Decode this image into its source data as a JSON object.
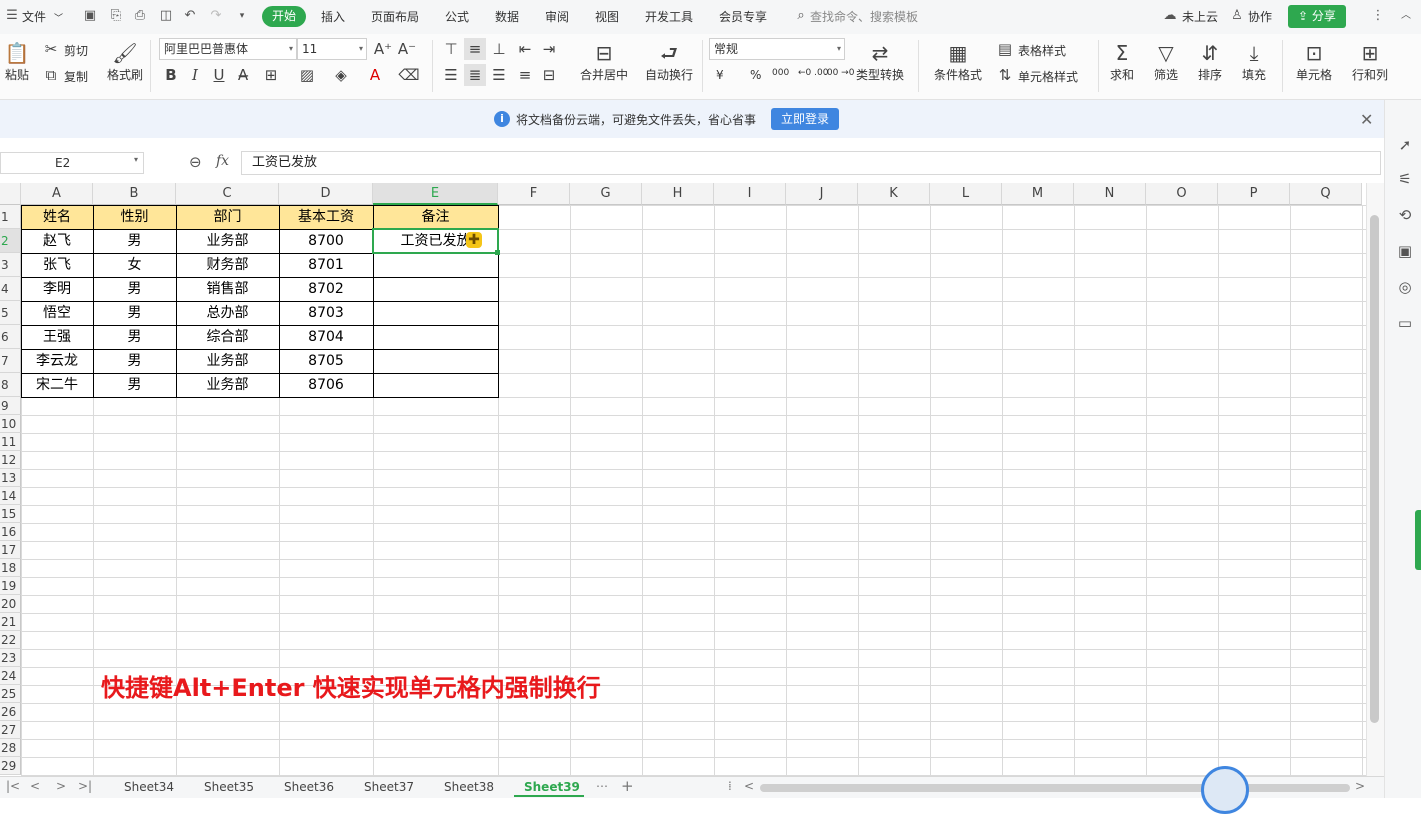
{
  "menu": {
    "file": "文件",
    "tabs": [
      "开始",
      "插入",
      "页面布局",
      "公式",
      "数据",
      "审阅",
      "视图",
      "开发工具",
      "会员专享"
    ],
    "search_placeholder": "查找命令、搜索模板",
    "cloud": "未上云",
    "collab": "协作",
    "share": "分享"
  },
  "ribbon": {
    "paste": "粘贴",
    "cut": "剪切",
    "copy": "复制",
    "format_painter": "格式刷",
    "font_name": "阿里巴巴普惠体",
    "font_size": "11",
    "merge_center": "合并居中",
    "wrap_text": "自动换行",
    "number_format": "常规",
    "currency": "¥",
    "percent": "%",
    "thousands": "000",
    "inc_decimal": "←0 .00",
    "dec_decimal": ".00 →0",
    "type_convert": "类型转换",
    "cond_format": "条件格式",
    "table_style": "表格样式",
    "cell_style": "单元格样式",
    "sum": "求和",
    "filter": "筛选",
    "sort": "排序",
    "fill": "填充",
    "cell": "单元格",
    "rows_cols": "行和列"
  },
  "notice": {
    "text": "将文档备份云端，可避免文件丢失，省心省事",
    "login": "立即登录"
  },
  "formula_bar": {
    "name_box": "E2",
    "fx": "fx",
    "content": "工资已发放"
  },
  "columns": [
    "A",
    "B",
    "C",
    "D",
    "E",
    "F",
    "G",
    "H",
    "I",
    "J",
    "K",
    "L",
    "M",
    "N",
    "O",
    "P",
    "Q"
  ],
  "rows": [
    "1",
    "2",
    "3",
    "4",
    "5",
    "6",
    "7",
    "8",
    "9",
    "10",
    "11",
    "12",
    "13",
    "14",
    "15",
    "16",
    "17",
    "18",
    "19",
    "20",
    "21",
    "22",
    "23",
    "24",
    "25",
    "26",
    "27",
    "28",
    "29"
  ],
  "table": {
    "headers": [
      "姓名",
      "性别",
      "部门",
      "基本工资",
      "备注"
    ],
    "rows": [
      [
        "赵飞",
        "男",
        "业务部",
        "8700",
        "工资已发放"
      ],
      [
        "张飞",
        "女",
        "财务部",
        "8701",
        ""
      ],
      [
        "李明",
        "男",
        "销售部",
        "8702",
        ""
      ],
      [
        "悟空",
        "男",
        "总办部",
        "8703",
        ""
      ],
      [
        "王强",
        "男",
        "综合部",
        "8704",
        ""
      ],
      [
        "李云龙",
        "男",
        "业务部",
        "8705",
        ""
      ],
      [
        "宋二牛",
        "男",
        "业务部",
        "8706",
        ""
      ]
    ]
  },
  "caption": "快捷键Alt+Enter 快速实现单元格内强制换行",
  "sheets": [
    "Sheet34",
    "Sheet35",
    "Sheet36",
    "Sheet37",
    "Sheet38",
    "Sheet39"
  ],
  "active_sheet": "Sheet39",
  "colors": {
    "accent": "#2ea84f",
    "header_fill": "#ffe699",
    "caption": "#e8191c",
    "notice_blue": "#3f86e0"
  }
}
